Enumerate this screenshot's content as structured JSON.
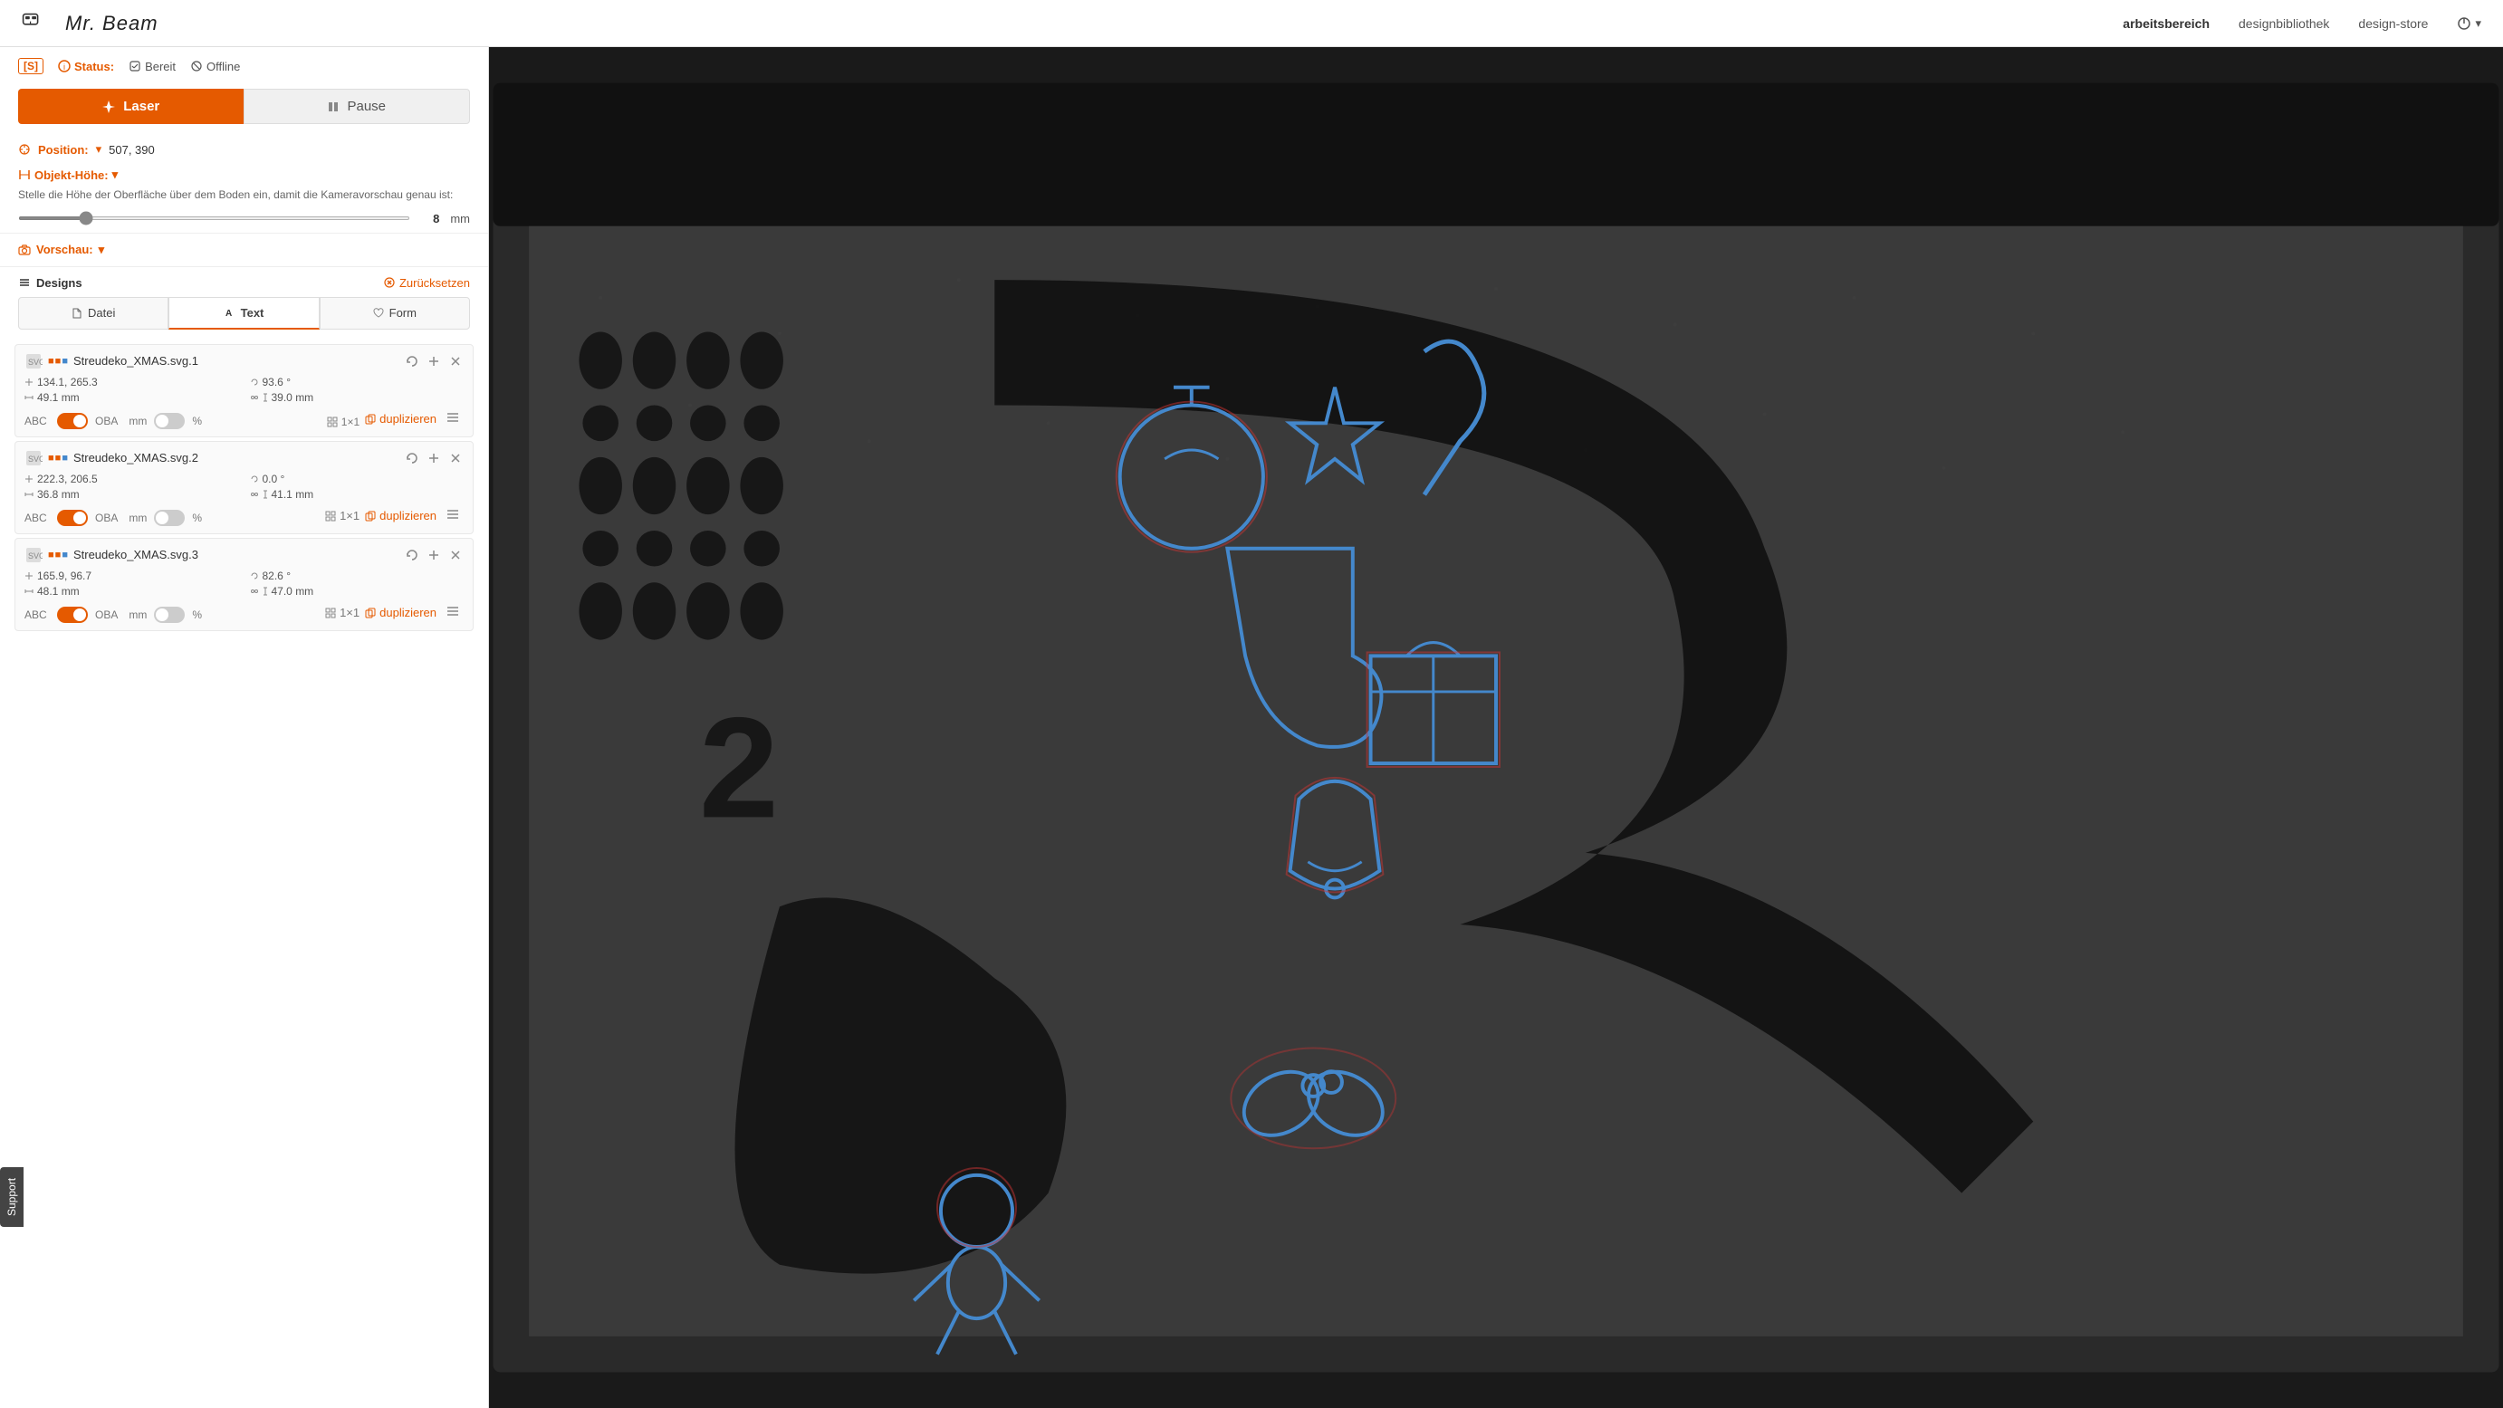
{
  "header": {
    "logo_text": "Mr. Beam",
    "nav": {
      "arbeitsbereich": "arbeitsbereich",
      "designbibliothek": "designbibliothek",
      "design_store": "design-store"
    },
    "active_nav": "arbeitsbereich"
  },
  "sidebar": {
    "status_s": "[S]",
    "status_label": "Status:",
    "status_bereit": "Bereit",
    "status_offline": "Offline",
    "laser_btn": "Laser",
    "pause_btn": "Pause",
    "position_label": "Position:",
    "position_value": "507, 390",
    "objekt_hohe_label": "Objekt-Höhe:",
    "objekt_hohe_desc": "Stelle die Höhe der Oberfläche über dem Boden ein, damit die Kameravorschau genau ist:",
    "slider_value": "8",
    "slider_unit": "mm",
    "vorschau_label": "Vorschau:",
    "designs_label": "Designs",
    "zuruck_label": "Zurücksetzen",
    "tab_datei": "Datei",
    "tab_text": "Text",
    "tab_form": "Form",
    "designs": [
      {
        "id": 1,
        "title": "Streudeko_XMAS.svg.1",
        "pos_x": "134.1",
        "pos_y": "265.3",
        "rotation": "93.6 °",
        "width": "49.1 mm",
        "height": "39.0 mm",
        "grid": "1×1",
        "abc_on": true,
        "oba_on": false,
        "mm_on": true,
        "pct_on": false,
        "dupli_label": "duplizieren"
      },
      {
        "id": 2,
        "title": "Streudeko_XMAS.svg.2",
        "pos_x": "222.3",
        "pos_y": "206.5",
        "rotation": "0.0 °",
        "width": "36.8 mm",
        "height": "41.1 mm",
        "grid": "1×1",
        "abc_on": true,
        "oba_on": false,
        "mm_on": true,
        "pct_on": false,
        "dupli_label": "duplizieren"
      },
      {
        "id": 3,
        "title": "Streudeko_XMAS.svg.3",
        "pos_x": "165.9",
        "pos_y": "96.7",
        "rotation": "82.6 °",
        "width": "48.1 mm",
        "height": "47.0 mm",
        "grid": "1×1",
        "abc_on": true,
        "oba_on": false,
        "mm_on": true,
        "pct_on": false,
        "dupli_label": "duplizieren"
      }
    ]
  },
  "support_label": "Support",
  "preview": {
    "bg_color": "#2a2a2a"
  }
}
